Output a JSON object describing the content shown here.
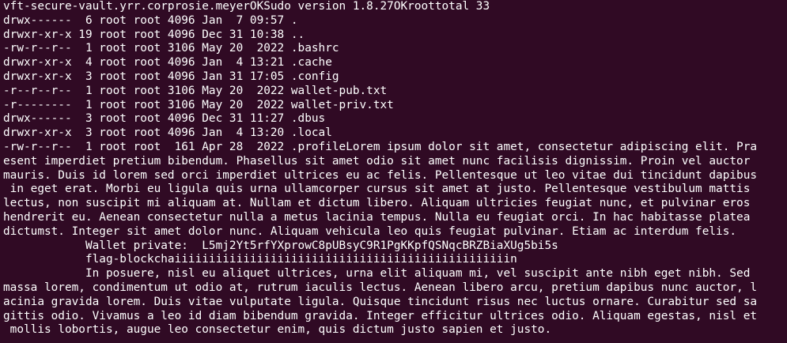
{
  "terminal": {
    "lines": [
      "vft-secure-vault.yrr.corprosie.meyerOKSudo version 1.8.27OKroottotal 33",
      "drwx------  6 root root 4096 Jan  7 09:57 .",
      "drwxr-xr-x 19 root root 4096 Dec 31 10:38 ..",
      "-rw-r--r--  1 root root 3106 May 20  2022 .bashrc",
      "drwxr-xr-x  4 root root 4096 Jan  4 13:21 .cache",
      "drwxr-xr-x  3 root root 4096 Jan 31 17:05 .config",
      "-r--r--r--  1 root root 3106 May 20  2022 wallet-pub.txt",
      "-r--------  1 root root 3106 May 20  2022 wallet-priv.txt",
      "drwx------  3 root root 4096 Dec 31 11:27 .dbus",
      "drwxr-xr-x  3 root root 4096 Jan  4 13:20 .local",
      "-rw-r--r--  1 root root  161 Apr 28  2022 .profileLorem ipsum dolor sit amet, consectetur adipiscing elit. Pra",
      "esent imperdiet pretium bibendum. Phasellus sit amet odio sit amet nunc facilisis dignissim. Proin vel auctor",
      "mauris. Duis id lorem sed orci imperdiet ultrices eu ac felis. Pellentesque ut leo vitae dui tincidunt dapibus",
      " in eget erat. Morbi eu ligula quis urna ullamcorper cursus sit amet at justo. Pellentesque vestibulum mattis",
      "lectus, non suscipit mi aliquam at. Nullam et dictum libero. Aliquam ultricies feugiat nunc, et pulvinar eros",
      "hendrerit eu. Aenean consectetur nulla a metus lacinia tempus. Nulla eu feugiat orci. In hac habitasse platea",
      "dictumst. Integer sit amet dolor nunc. Aliquam vehicula leo quis feugiat pulvinar. Etiam ac interdum felis.",
      "            Wallet private:  L5mj2Yt5rfYXprowC8pUBsyC9R1PgKKpfQSNqcBRZBiaXUg5bi5s",
      "            flag-blockchaiiiiiiiiiiiiiiiiiiiiiiiiiiiiiiiiiiiiiiiiiiiiiiiiin",
      "            In posuere, nisl eu aliquet ultrices, urna elit aliquam mi, vel suscipit ante nibh eget nibh. Sed",
      "massa lorem, condimentum ut odio at, rutrum iaculis lectus. Aenean libero arcu, pretium dapibus nunc auctor, l",
      "acinia gravida lorem. Duis vitae vulputate ligula. Quisque tincidunt risus nec luctus ornare. Curabitur sed sa",
      "gittis odio. Vivamus a leo id diam bibendum gravida. Integer efficitur ultrices odio. Aliquam egestas, nisl et",
      " mollis lobortis, augue leo consectetur enim, quis dictum justo sapien et justo."
    ]
  }
}
